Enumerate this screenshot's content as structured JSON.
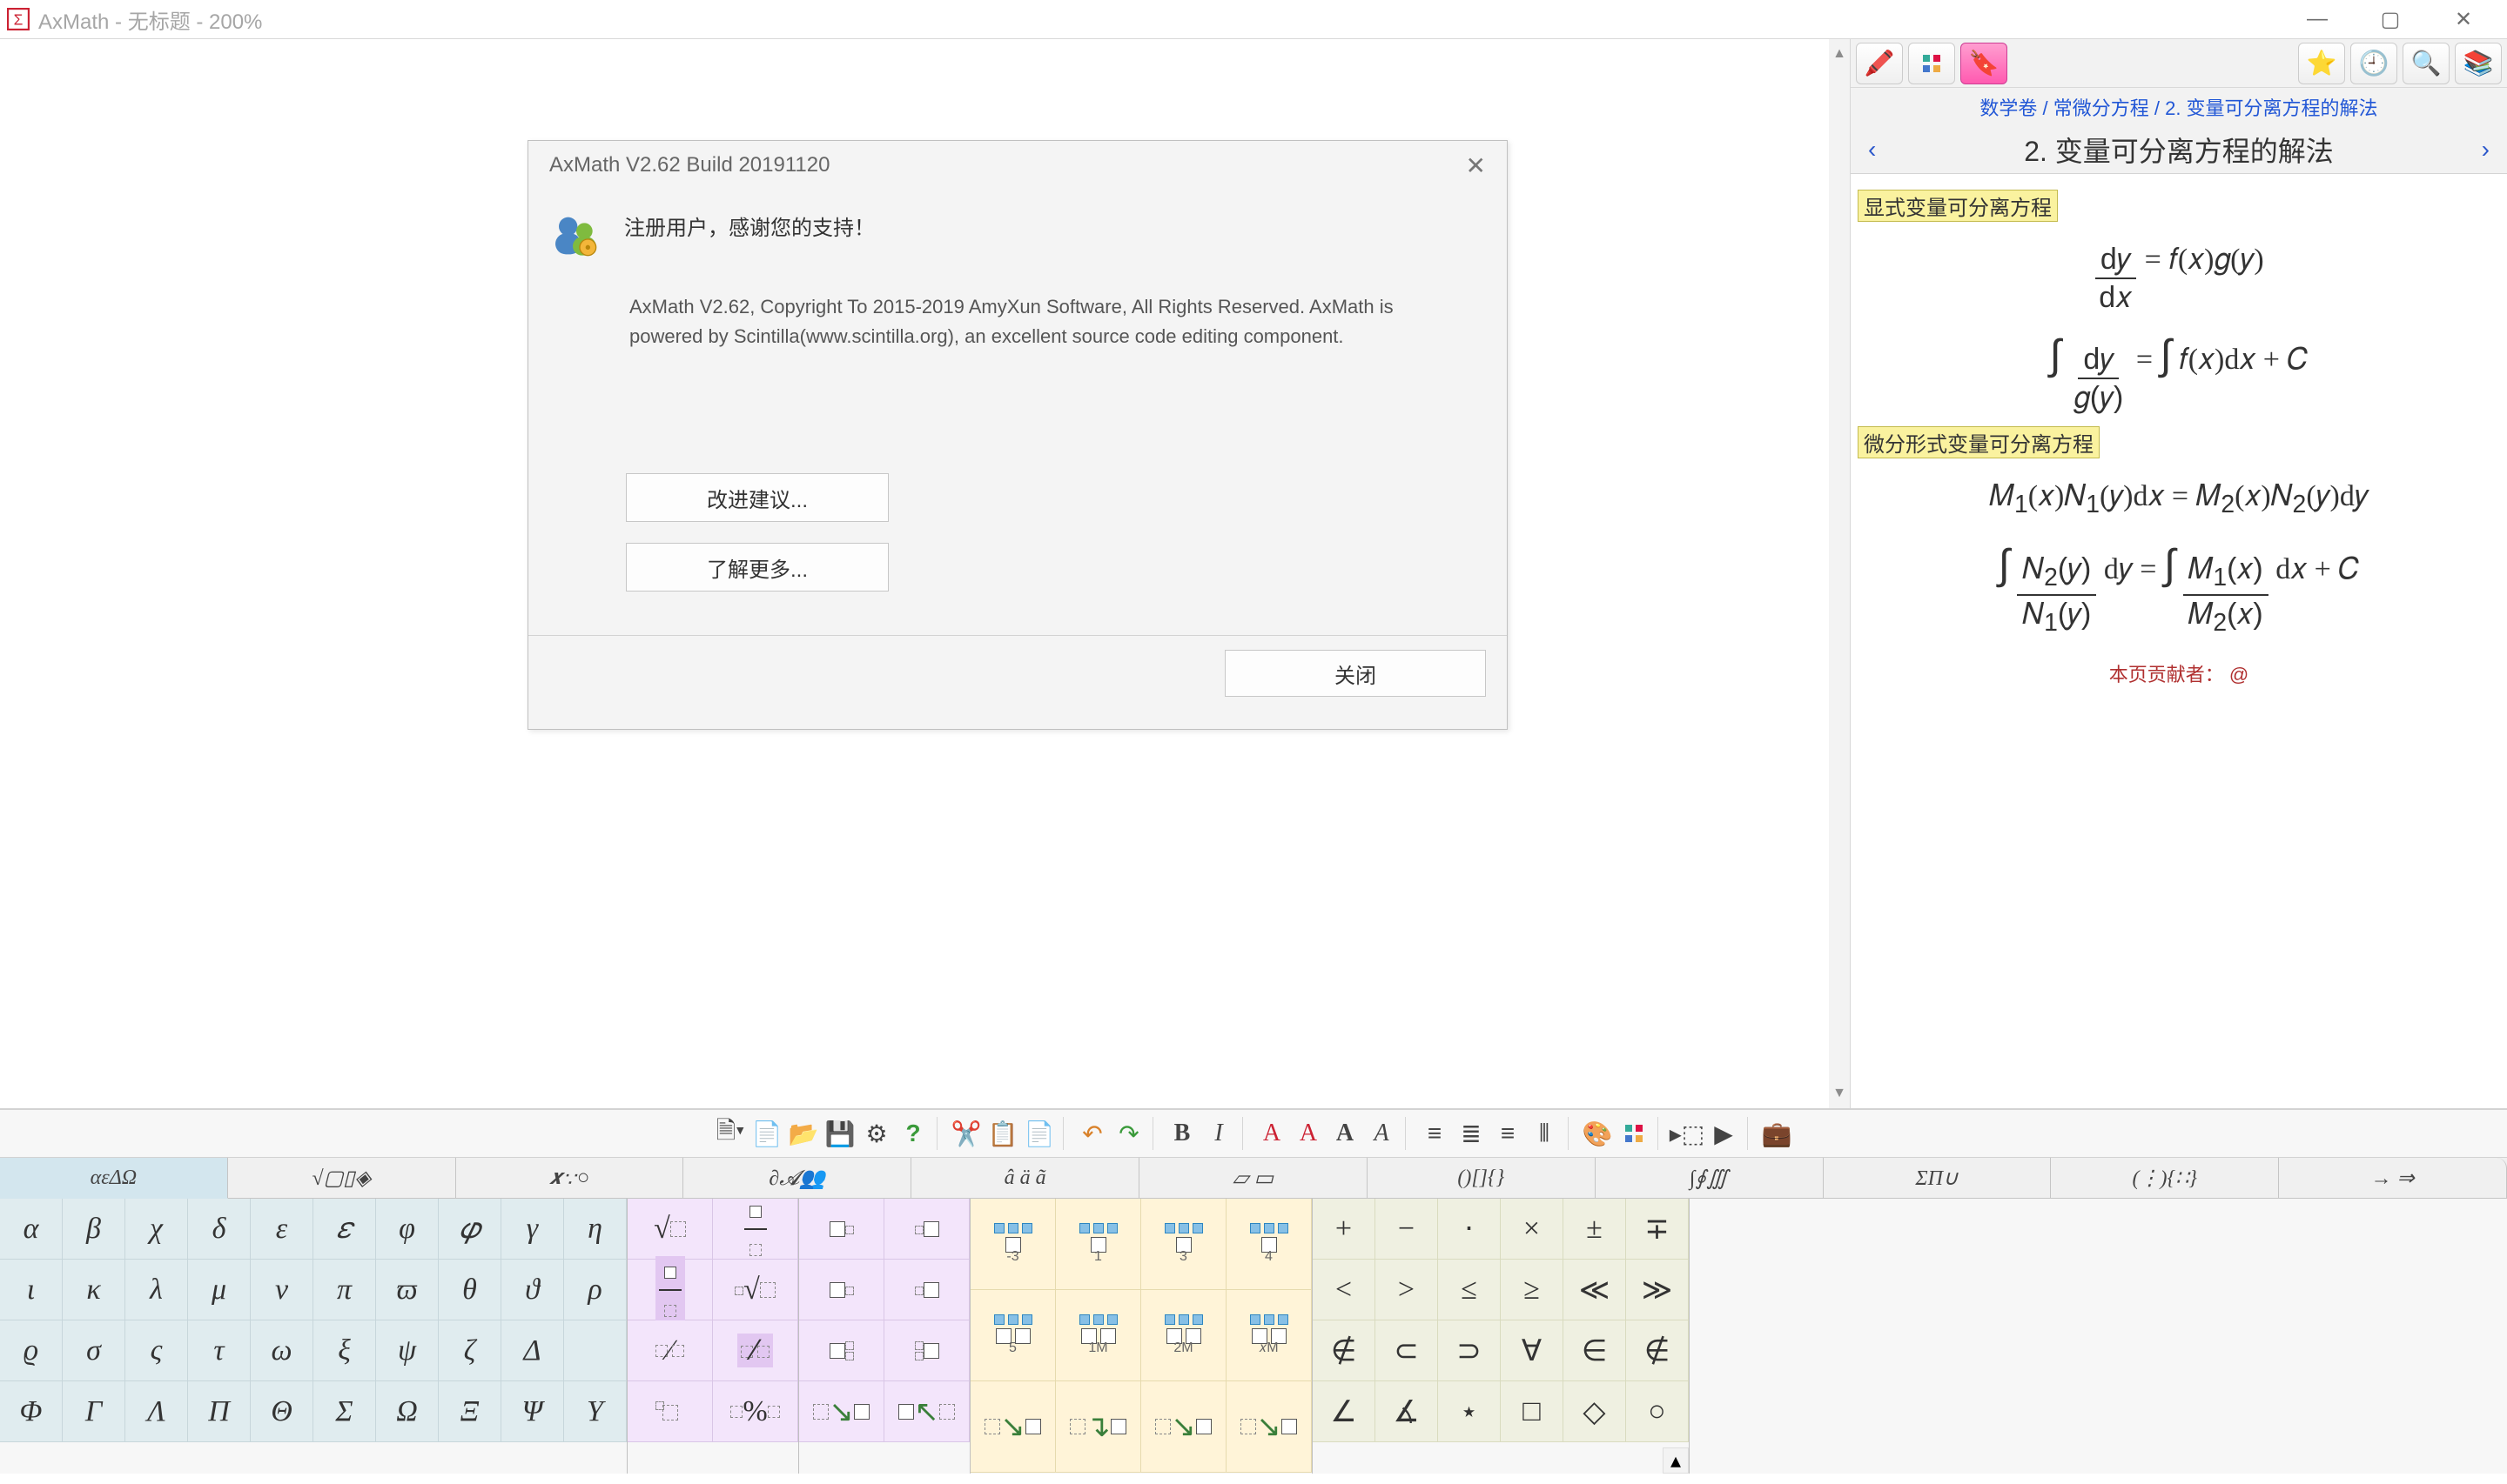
{
  "window": {
    "title": "AxMath - 无标题 - 200%",
    "minimize": "—",
    "maximize": "▢",
    "close": "✕"
  },
  "dialog": {
    "title": "AxMath V2.62 Build 20191120",
    "message": "注册用户，感谢您的支持！",
    "copyright": "AxMath V2.62, Copyright To 2015-2019 AmyXun Software, All Rights Reserved. AxMath is powered by Scintilla(www.scintilla.org), an excellent source code editing component.",
    "btn_suggest": "改进建议...",
    "btn_more": "了解更多...",
    "btn_close": "关闭"
  },
  "ref": {
    "breadcrumb": "数学卷 / 常微分方程 / 2. 变量可分离方程的解法",
    "title": "2. 变量可分离方程的解法",
    "heading1": "显式变量可分离方程",
    "formula1": "d𝑦 / d𝑥 = 𝑓(𝑥) 𝑔(𝑦)",
    "formula2": "∫ d𝑦 / 𝑔(𝑦) = ∫ 𝑓(𝑥) d𝑥 + 𝐶",
    "heading2": "微分形式变量可分离方程",
    "formula3": "𝑀₁(𝑥)𝑁₁(𝑦) d𝑥 = 𝑀₂(𝑥)𝑁₂(𝑦) d𝑦",
    "formula4": "∫ 𝑁₂(𝑦)/𝑁₁(𝑦) d𝑦 = ∫ 𝑀₁(𝑥)/𝑀₂(𝑥) d𝑥 + 𝐶",
    "contributor": "本页贡献者： @"
  },
  "tabs": {
    "t1": "αεΔΩ",
    "t2": "√▢▯◈",
    "t3": "𝒙∵○",
    "t4": "∂𝓐👥",
    "t5": "â ä ã",
    "t6": "▱ ▭",
    "t7": "()[]{}",
    "t8": "∫∮∭",
    "t9": "ΣΠ∪",
    "t10": "(⋮){∷}",
    "t11": "→ ⇒"
  },
  "greek": [
    [
      "α",
      "β",
      "χ",
      "δ",
      "ε",
      "𝜀",
      "φ",
      "𝜑",
      "γ",
      "η"
    ],
    [
      "ι",
      "κ",
      "λ",
      "μ",
      "ν",
      "π",
      "ϖ",
      "θ",
      "ϑ",
      "ρ"
    ],
    [
      "ϱ",
      "σ",
      "ς",
      "τ",
      "ω",
      "ξ",
      "ψ",
      "ζ",
      "Δ",
      ""
    ],
    [
      "Φ",
      "Γ",
      "Λ",
      "Π",
      "Θ",
      "Σ",
      "Ω",
      "Ξ",
      "Ψ",
      "Υ"
    ]
  ],
  "subs3": [
    "-3",
    "1",
    "3",
    "4",
    "5",
    "1M",
    "2M",
    "𝑥M"
  ],
  "ops": [
    [
      "+",
      "−",
      "⋅",
      "×",
      "±",
      "∓"
    ],
    [
      "<",
      ">",
      "≤",
      "≥",
      "≪",
      "≫"
    ],
    [
      "∉",
      "⊂",
      "⊃",
      "∀",
      "∈",
      "∉"
    ],
    [
      "∠",
      "∡",
      "⋆",
      "□",
      "◇",
      "○"
    ]
  ]
}
